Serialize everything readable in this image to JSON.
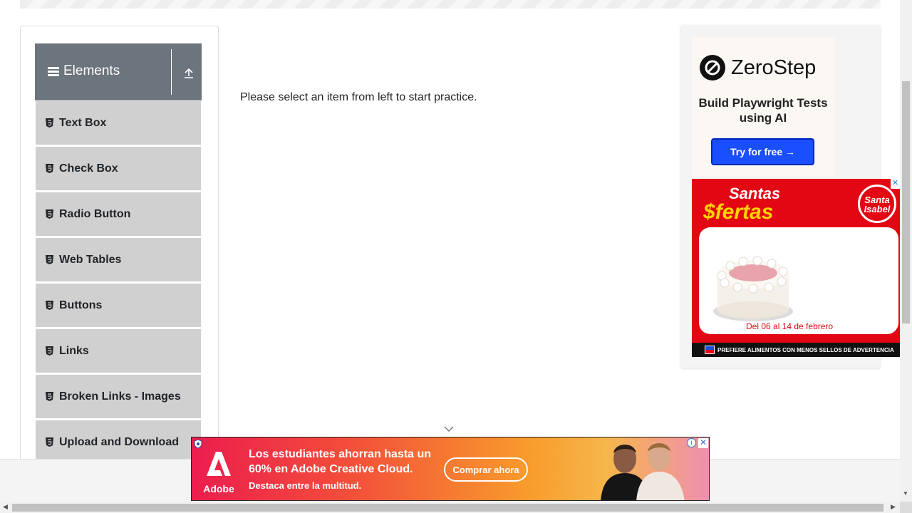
{
  "sidebar": {
    "group_title": "Elements",
    "items": [
      {
        "label": "Text Box"
      },
      {
        "label": "Check Box"
      },
      {
        "label": "Radio Button"
      },
      {
        "label": "Web Tables"
      },
      {
        "label": "Buttons"
      },
      {
        "label": "Links"
      },
      {
        "label": "Broken Links - Images"
      },
      {
        "label": "Upload and Download"
      }
    ]
  },
  "main": {
    "instruction": "Please select an item from left to start practice."
  },
  "ads": {
    "zerostep": {
      "brand": "ZeroStep",
      "tagline": "Build Playwright Tests using AI",
      "cta": "Try for free →"
    },
    "santa_isabel": {
      "title_line1": "Santas",
      "title_line2": "$fertas",
      "logo_text": "Santa Isabel",
      "date": "Del 06 al 14 de febrero",
      "footer": "PREFIERE ALIMENTOS CON MENOS SELLOS DE ADVERTENCIA"
    },
    "adobe": {
      "brand": "Adobe",
      "headline": "Los estudiantes ahorran hasta un 60% en Adobe Creative Cloud.",
      "subline": "Destaca entre la multitud.",
      "cta": "Comprar ahora"
    }
  },
  "colors": {
    "sidebar_header": "#6c757d",
    "menu_item_bg": "#d0d0d0",
    "zerostep_button": "#1a4fff",
    "santa_isabel_red": "#e30613"
  }
}
